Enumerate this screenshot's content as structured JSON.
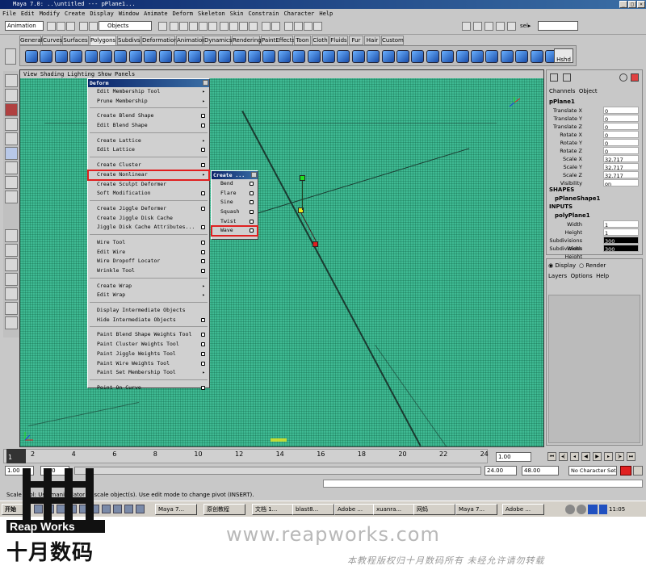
{
  "window": {
    "title": "Maya 7.0: ..\\untitled  ---  pPlane1..."
  },
  "menubar": [
    "File",
    "Edit",
    "Modify",
    "Create",
    "Display",
    "Window",
    "Animate",
    "Deform",
    "Skeleton",
    "Skin",
    "Constrain",
    "Character",
    "Help"
  ],
  "statusline": {
    "mode": "Animation",
    "objects_field": "Objects",
    "sel_label": "sel▸"
  },
  "shelf_tabs": [
    "General",
    "Curves",
    "Surfaces",
    "Polygons",
    "Subdivs",
    "Deformation",
    "Animation",
    "Dynamics",
    "Rendering",
    "PaintEffects",
    "Toon",
    "Cloth",
    "Fluids",
    "Fur",
    "Hair",
    "Custom"
  ],
  "shelf": {
    "hshd_label": "Hshd"
  },
  "panel_menu": [
    "View",
    "Shading",
    "Lighting",
    "Show",
    "Panels"
  ],
  "deform_menu": {
    "title": "Deform",
    "items": [
      "Edit Membership Tool",
      "Prune Membership",
      "Create Blend Shape",
      "Edit Blend Shape",
      "Create Lattice",
      "Edit Lattice",
      "Create Cluster",
      "Create Nonlinear",
      "Create Sculpt Deformer",
      "Soft Modification",
      "Create Jiggle Deformer",
      "Create Jiggle Disk Cache",
      "Jiggle Disk Cache Attributes...",
      "Wire Tool",
      "Edit Wire",
      "Wire Dropoff Locator",
      "Wrinkle Tool",
      "Create Wrap",
      "Edit Wrap",
      "Display Intermediate Objects",
      "Hide Intermediate Objects",
      "Paint Blend Shape Weights Tool",
      "Paint Cluster Weights Tool",
      "Paint Jiggle Weights Tool",
      "Paint Wire Weights Tool",
      "Paint Set Membership Tool",
      "Point On Curve"
    ]
  },
  "nonlinear_menu": {
    "title": "Create ...",
    "items": [
      "Bend",
      "Flare",
      "Sine",
      "Squash",
      "Twist",
      "Wave"
    ]
  },
  "channel_box": {
    "tabs": [
      "Channels",
      "Object"
    ],
    "object_name": "pPlane1",
    "channels": [
      {
        "label": "Translate X",
        "value": "0"
      },
      {
        "label": "Translate Y",
        "value": "0"
      },
      {
        "label": "Translate Z",
        "value": "0"
      },
      {
        "label": "Rotate X",
        "value": "0"
      },
      {
        "label": "Rotate Y",
        "value": "0"
      },
      {
        "label": "Rotate Z",
        "value": "0"
      },
      {
        "label": "Scale X",
        "value": "32.717"
      },
      {
        "label": "Scale Y",
        "value": "32.717"
      },
      {
        "label": "Scale Z",
        "value": "32.717"
      },
      {
        "label": "Visibility",
        "value": "on"
      }
    ],
    "shapes_header": "SHAPES",
    "shape_name": "pPlaneShape1",
    "inputs_header": "INPUTS",
    "input_name": "polyPlane1",
    "inputs": [
      {
        "label": "Width",
        "value": "1"
      },
      {
        "label": "Height",
        "value": "1"
      },
      {
        "label": "Subdivisions Width",
        "value": "300"
      },
      {
        "label": "Subdivisions Height",
        "value": "300"
      }
    ]
  },
  "layer_editor": {
    "display_label": "Display",
    "render_label": "Render",
    "menus": [
      "Layers",
      "Options",
      "Help"
    ]
  },
  "timeline": {
    "ticks": [
      "2",
      "4",
      "6",
      "8",
      "10",
      "12",
      "14",
      "16",
      "18",
      "20",
      "22",
      "24"
    ],
    "current_frame_label": "1",
    "current_time": "1.00"
  },
  "range": {
    "start": "1.00",
    "start2": "1.00",
    "end": "24.00",
    "end2": "48.00",
    "character": "No Character Set"
  },
  "helpline": "Scale Tool: Use manipulator to scale object(s). Use edit mode to change pivot (INSERT).",
  "taskbar": {
    "start": "开始",
    "tasks": [
      "Maya 7...",
      "原创教程",
      "文档 1...",
      "blast8...",
      "Adobe ...",
      "xuanra...",
      "网蚂",
      "Maya 7...",
      "Adobe ..."
    ],
    "clock": "11:05"
  },
  "branding": {
    "reap_works": "Reap Works",
    "chinese_name": "十月数码",
    "url": "www.reapworks.com",
    "copyright": "本教程版权归十月数码所有 未经允许请勿转载"
  }
}
